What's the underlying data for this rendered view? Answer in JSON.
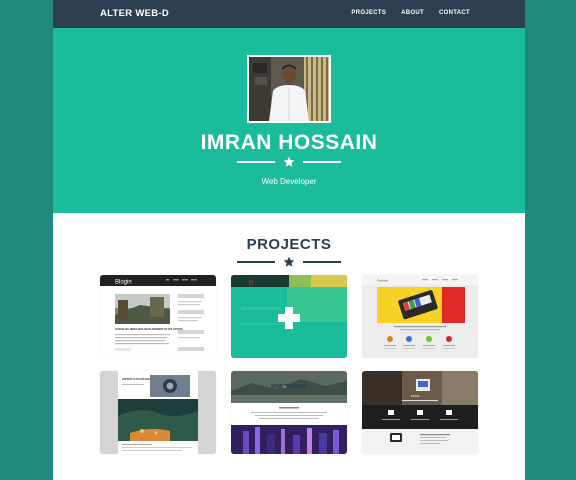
{
  "nav": {
    "brand": "ALTER WEB-D",
    "links": [
      "PROJECTS",
      "ABOUT",
      "CONTACT"
    ]
  },
  "hero": {
    "name": "IMRAN HOSSAIN",
    "subtitle": "Web Developer"
  },
  "projects": {
    "title": "PROJECTS",
    "items": [
      {
        "thumb_label": "Blogin",
        "thumb_text": "OUR BLOG NEWS DOLOR IN ANWERIT IN VOLUPTATE"
      },
      {
        "thumb_label": "|||",
        "hover_icon": "plus-icon"
      },
      {
        "thumb_label": "Portfolio"
      },
      {
        "thumb_label": "ARTIST'S PHOTOGRAPHY"
      },
      {
        "thumb_label": "City"
      },
      {
        "thumb_label": "Mobile"
      }
    ]
  },
  "colors": {
    "nav": "#2c3e50",
    "hero": "#1abc9c",
    "outer": "#1f8a7d",
    "title": "#2c3e50"
  }
}
